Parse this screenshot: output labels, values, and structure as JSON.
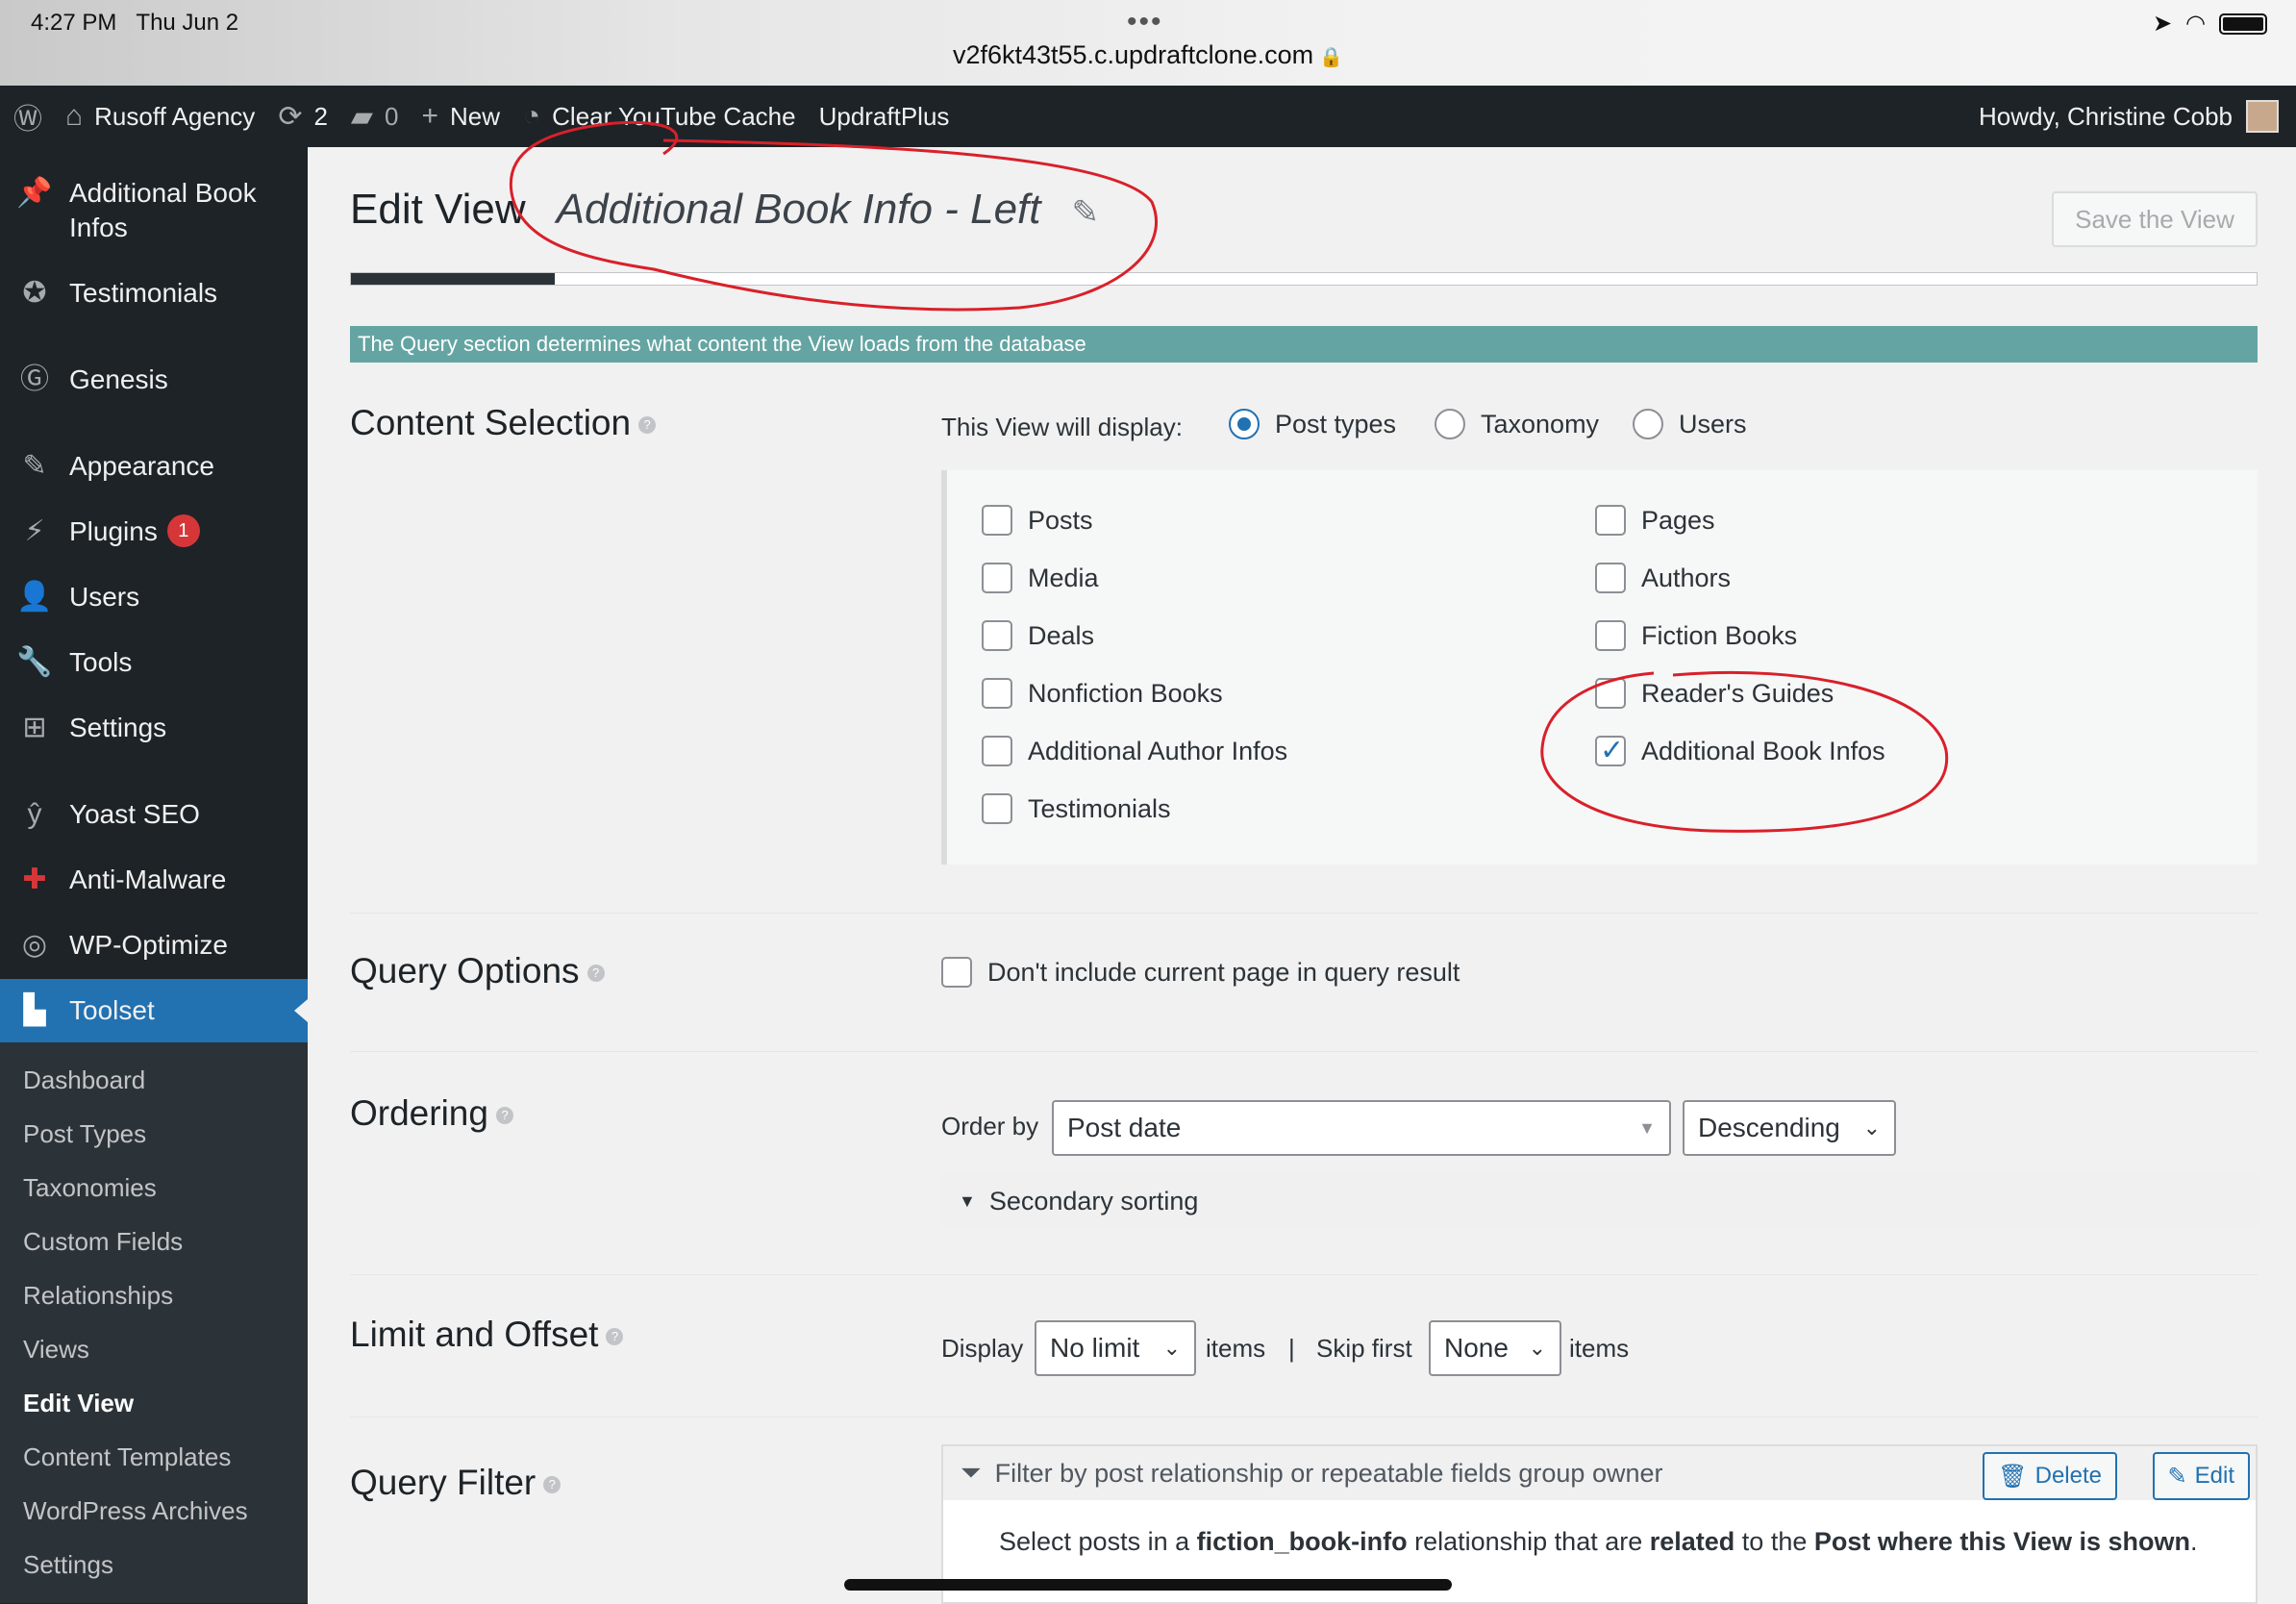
{
  "ios": {
    "time": "4:27 PM",
    "date": "Thu Jun 2",
    "url": "v2f6kt43t55.c.updraftclone.com"
  },
  "adminbar": {
    "site_name": "Rusoff Agency",
    "updates_count": "2",
    "comments_count": "0",
    "new_label": "New",
    "cache_label": "Clear YouTube Cache",
    "updraft_label": "UpdraftPlus",
    "howdy": "Howdy, Christine Cobb"
  },
  "sidebar": {
    "items": [
      {
        "label": "Additional Book Infos"
      },
      {
        "label": "Testimonials"
      },
      {
        "label": "Genesis"
      },
      {
        "label": "Appearance"
      },
      {
        "label": "Plugins",
        "badge": "1"
      },
      {
        "label": "Users"
      },
      {
        "label": "Tools"
      },
      {
        "label": "Settings"
      },
      {
        "label": "Yoast SEO"
      },
      {
        "label": "Anti-Malware"
      },
      {
        "label": "WP-Optimize"
      },
      {
        "label": "Toolset"
      }
    ],
    "submenu": [
      "Dashboard",
      "Post Types",
      "Taxonomies",
      "Custom Fields",
      "Relationships",
      "Views",
      "Edit View",
      "Content Templates",
      "WordPress Archives",
      "Settings"
    ]
  },
  "header": {
    "title": "Edit View",
    "view_name": "Additional Book Info - Left",
    "save_button": "Save the View",
    "progress": 0.107
  },
  "notice": "The Query section determines what content the View loads from the database",
  "content_selection": {
    "label": "Content Selection",
    "display_label": "This View will display:",
    "radios": [
      "Post types",
      "Taxonomy",
      "Users"
    ],
    "selected_radio": "Post types",
    "post_types_left": [
      "Posts",
      "Media",
      "Deals",
      "Nonfiction Books",
      "Additional Author Infos",
      "Testimonials"
    ],
    "post_types_right": [
      "Pages",
      "Authors",
      "Fiction Books",
      "Reader's Guides",
      "Additional Book Infos"
    ],
    "checked": [
      "Additional Book Infos"
    ]
  },
  "query_options": {
    "label": "Query Options",
    "checkbox_label": "Don't include current page in query result"
  },
  "ordering": {
    "label": "Ordering",
    "order_by_label": "Order by",
    "order_by_value": "Post date",
    "direction_value": "Descending",
    "secondary_label": "Secondary sorting"
  },
  "limit_offset": {
    "label": "Limit and Offset",
    "display_label": "Display",
    "limit_value": "No limit",
    "items_label": "items",
    "separator": "|",
    "skip_label": "Skip first",
    "skip_value": "None",
    "items_label2": "items"
  },
  "query_filter": {
    "label": "Query Filter",
    "filter_title": "Filter by post relationship or repeatable fields group owner",
    "delete_label": "Delete",
    "edit_label": "Edit",
    "desc_1": "Select posts in a ",
    "desc_rel": "fiction_book-info",
    "desc_2": " relationship that are ",
    "desc_related": "related",
    "desc_3": " to the ",
    "desc_target": "Post where this View is shown",
    "desc_4": "."
  },
  "colors": {
    "admin_dark": "#1d2327",
    "accent": "#2271b1",
    "notice": "#64a5a3",
    "annotation": "#d9202a"
  }
}
